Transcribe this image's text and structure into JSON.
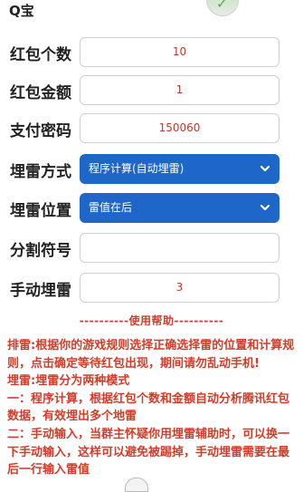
{
  "header": {
    "title": "Q宝"
  },
  "form": {
    "packet_count": {
      "label": "红包个数",
      "value": "10"
    },
    "packet_amount": {
      "label": "红包金额",
      "value": "1"
    },
    "pay_password": {
      "label": "支付密码",
      "value": "150060"
    },
    "mine_mode": {
      "label": "埋雷方式",
      "selected": "程序计算(自动埋雷)"
    },
    "mine_position": {
      "label": "埋雷位置",
      "selected": "雷值在后"
    },
    "separator": {
      "label": "分割符号",
      "value": ""
    },
    "manual_mine": {
      "label": "手动埋雷",
      "value": "3"
    }
  },
  "help": {
    "title": "----------使用帮助----------",
    "lines": [
      "排雷:根据你的游戏规则选择正确选择雷的位置和计算规则，点击确定等待红包出现，期间请勿乱动手机!",
      "埋雷:埋雷分为两种模式",
      "一：程序计算，根据红包个数和金额自动分析腾讯红包数据，有效埋出多个地雷",
      "二：手动输入，当群主怀疑你用埋雷辅助时，可以换一下手动输入，这样可以避免被踢掉，手动埋雷需要在最后一行输入雷值"
    ]
  },
  "colors": {
    "accent_red": "#d23c2a",
    "select_blue": "#1f66c9"
  }
}
